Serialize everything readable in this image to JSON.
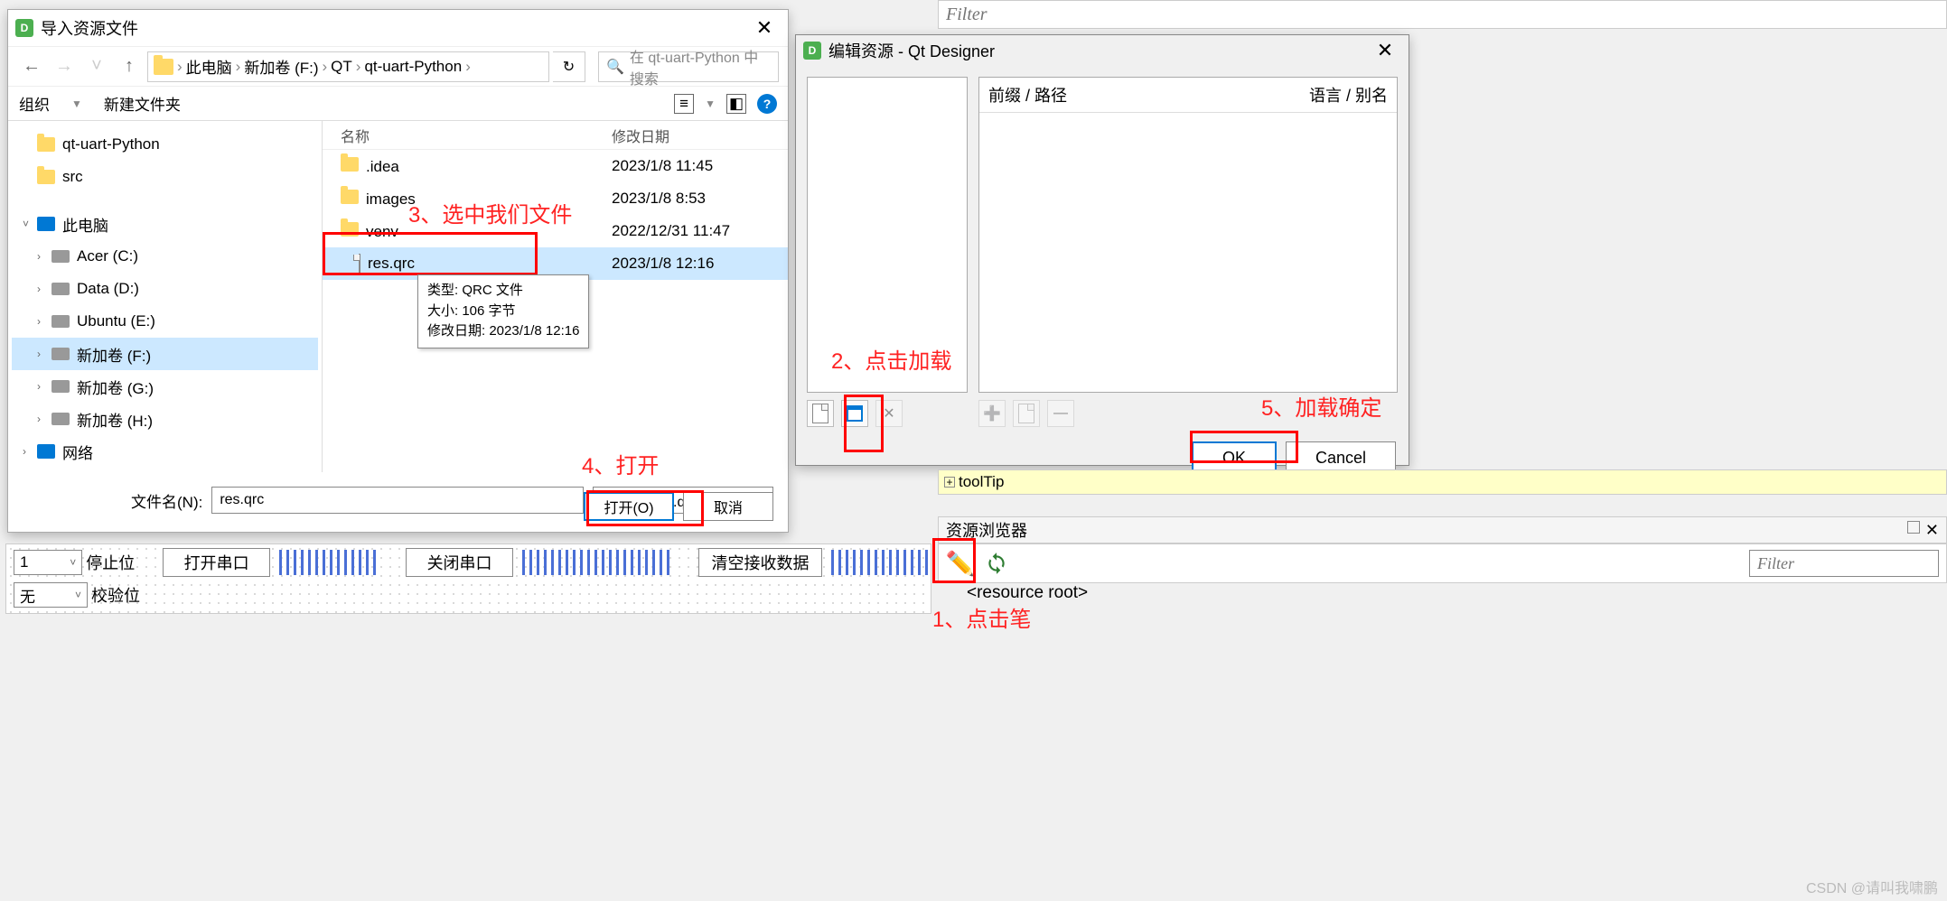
{
  "file_dialog": {
    "title": "导入资源文件",
    "breadcrumb": [
      "此电脑",
      "新加卷 (F:)",
      "QT",
      "qt-uart-Python"
    ],
    "search_placeholder": "在 qt-uart-Python 中搜索",
    "toolbar": {
      "organize": "组织",
      "new_folder": "新建文件夹"
    },
    "tree": [
      {
        "label": "qt-uart-Python",
        "type": "folder",
        "indent": 1
      },
      {
        "label": "src",
        "type": "folder",
        "indent": 1
      },
      {
        "label": "此电脑",
        "type": "pc",
        "indent": 0,
        "expanded": true
      },
      {
        "label": "Acer (C:)",
        "type": "drive",
        "indent": 1
      },
      {
        "label": "Data (D:)",
        "type": "drive",
        "indent": 1
      },
      {
        "label": "Ubuntu (E:)",
        "type": "drive",
        "indent": 1
      },
      {
        "label": "新加卷 (F:)",
        "type": "drive",
        "indent": 1,
        "selected": true
      },
      {
        "label": "新加卷 (G:)",
        "type": "drive",
        "indent": 1
      },
      {
        "label": "新加卷 (H:)",
        "type": "drive",
        "indent": 1
      },
      {
        "label": "网络",
        "type": "net",
        "indent": 0
      }
    ],
    "columns": {
      "name": "名称",
      "modified": "修改日期"
    },
    "files": [
      {
        "name": ".idea",
        "type": "folder",
        "date": "2023/1/8 11:45"
      },
      {
        "name": "images",
        "type": "folder",
        "date": "2023/1/8 8:53"
      },
      {
        "name": "venv",
        "type": "folder",
        "date": "2022/12/31 11:47"
      },
      {
        "name": "res.qrc",
        "type": "file",
        "date": "2023/1/8 12:16",
        "selected": true
      }
    ],
    "tooltip": {
      "line1": "类型: QRC 文件",
      "line2": "大小: 106 字节",
      "line3": "修改日期: 2023/1/8 12:16"
    },
    "filename_label": "文件名(N):",
    "filename_value": "res.qrc",
    "filter_value": "资源文件 (*.qrc)",
    "open_btn": "打开(O)",
    "cancel_btn": "取消"
  },
  "resource_dialog": {
    "title": "编辑资源 - Qt Designer",
    "col_prefix": "前缀 / 路径",
    "col_lang": "语言 / 别名",
    "ok_btn": "OK",
    "cancel_btn": "Cancel"
  },
  "annotations": {
    "a1": "1、点击笔",
    "a2": "2、点击加载",
    "a3": "3、选中我们文件",
    "a4": "4、打开",
    "a5": "5、加载确定"
  },
  "top_filter_placeholder": "Filter",
  "form": {
    "combo1": "1",
    "label1": "停止位",
    "combo2": "无",
    "label2": "校验位",
    "btn_open": "打开串口",
    "btn_close": "关闭串口",
    "btn_clear": "清空接收数据"
  },
  "props": {
    "tooltip": "toolTip"
  },
  "res_browser": {
    "title": "资源浏览器",
    "filter": "Filter",
    "root": "<resource root>"
  },
  "watermark": "CSDN @请叫我啸鹏"
}
